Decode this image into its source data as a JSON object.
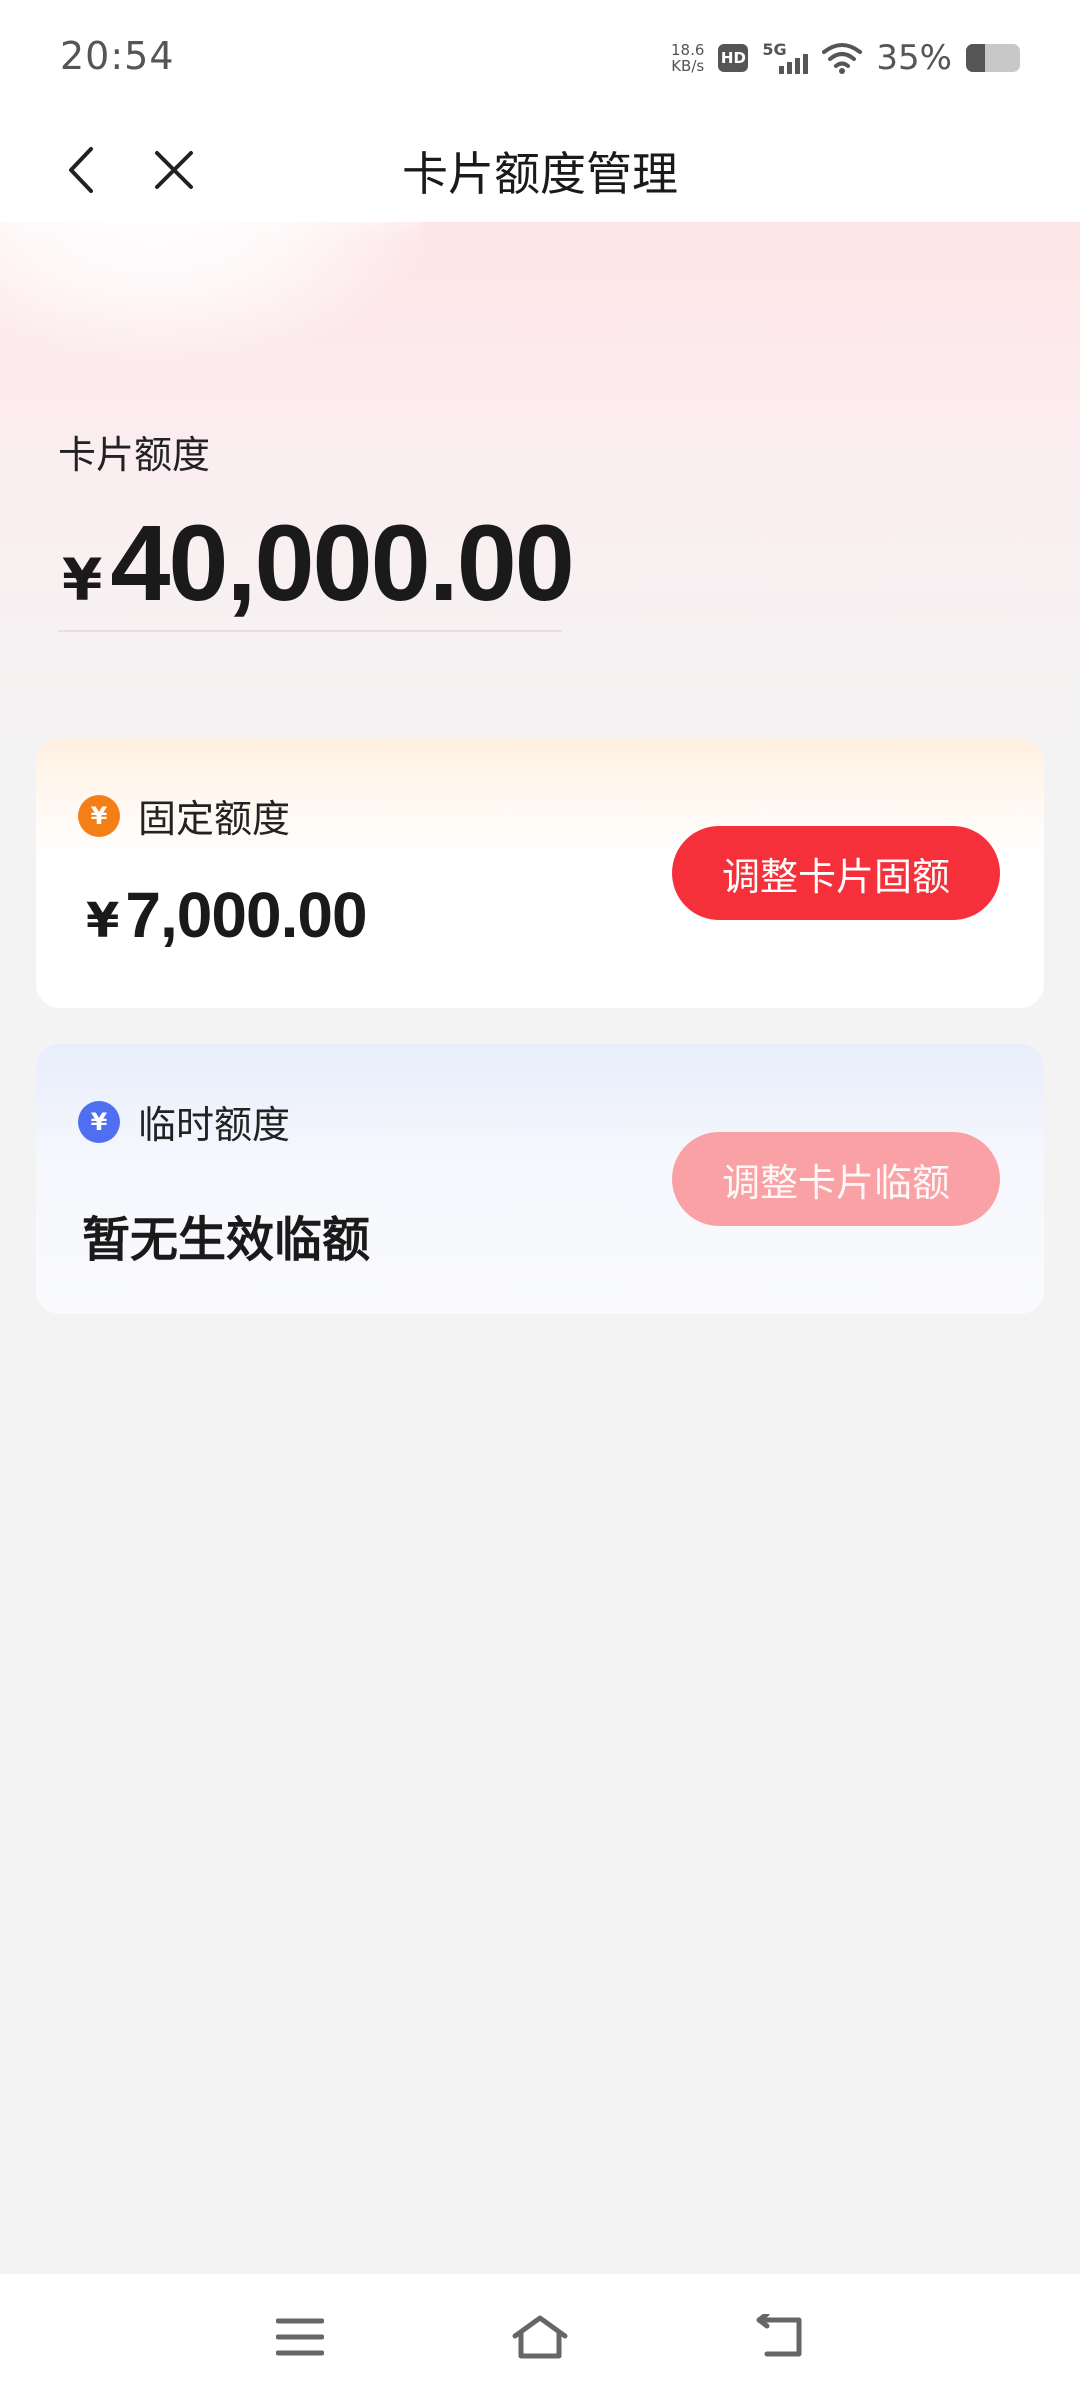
{
  "status_bar": {
    "time": "20:54",
    "net_speed_value": "18.6",
    "net_speed_unit": "KB/s",
    "hd_label": "HD",
    "network_type": "5G",
    "battery_percent": "35%",
    "battery_level": 0.35
  },
  "nav": {
    "title": "卡片额度管理",
    "back_icon": "chevron-left-icon",
    "close_icon": "close-icon"
  },
  "total": {
    "label": "卡片额度",
    "currency": "¥",
    "amount": "40,000.00"
  },
  "fixed_card": {
    "title": "固定额度",
    "icon_glyph": "¥",
    "currency": "¥",
    "amount": "7,000.00",
    "button_label": "调整卡片固额",
    "accent": "#f57f17"
  },
  "temp_card": {
    "title": "临时额度",
    "icon_glyph": "¥",
    "empty_text": "暂无生效临额",
    "button_label": "调整卡片临额",
    "accent": "#4f6ef0"
  },
  "bottom_nav": {
    "menu_icon": "menu-icon",
    "home_icon": "home-icon",
    "back_icon": "return-icon"
  },
  "colors": {
    "primary_button": "#f5303a",
    "disabled_button": "#f9a1a5",
    "header_bg": "#fde3e5"
  }
}
